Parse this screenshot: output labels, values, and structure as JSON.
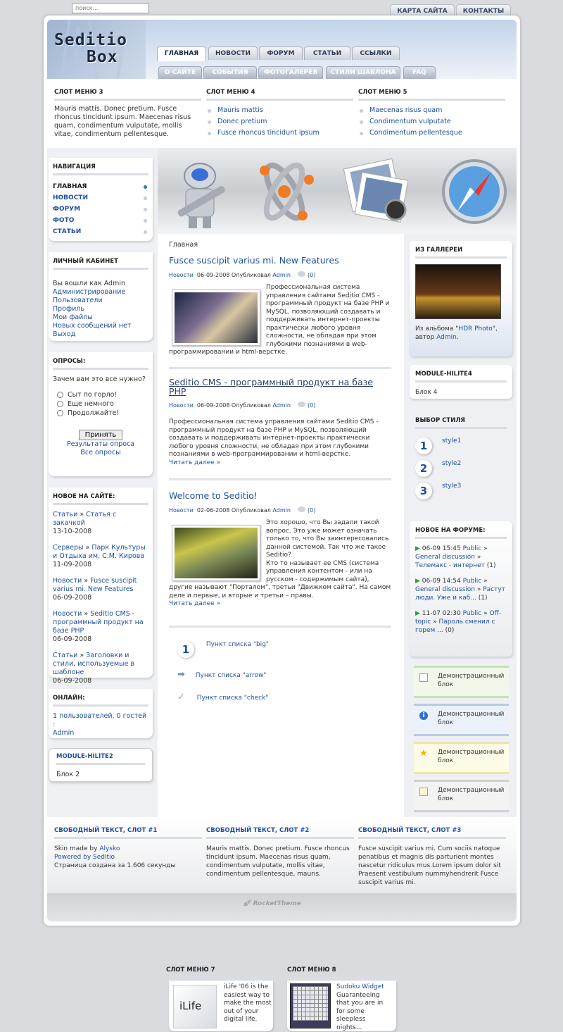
{
  "search": {
    "placeholder": "поиск..."
  },
  "top_tabs": [
    "КАРТА САЙТА",
    "КОНТАКТЫ"
  ],
  "logo": {
    "line1": "Seditio",
    "line2": "Box"
  },
  "main_tabs": [
    "ГЛАВНАЯ",
    "НОВОСТИ",
    "ФОРУМ",
    "СТАТЬИ",
    "ССЫЛКИ"
  ],
  "sub_tabs": [
    "О САЙТЕ",
    "СОБЫТИЯ",
    "ФОТОГАЛЕРЕЯ",
    "СТИЛИ ШАБЛОНА",
    "FAQ"
  ],
  "slot3": {
    "title": "СЛОТ МЕНЮ 3",
    "text": "Mauris mattis. Donec pretium. Fusce rhoncus tincidunt ipsum. Maecenas risus quam, condimentum vulputate, mollis vitae, condimentum pellentesque."
  },
  "slot4": {
    "title": "СЛОТ МЕНЮ 4",
    "items": [
      "Mauris mattis",
      "Donec pretium",
      "Fusce rhoncus tincidunt ipsum"
    ]
  },
  "slot5": {
    "title": "СЛОТ МЕНЮ 5",
    "items": [
      "Maecenas risus quam",
      "Condimentum vulputate",
      "Condimentum pellentesque"
    ]
  },
  "nav": {
    "title": "НАВИГАЦИЯ",
    "items": [
      "ГЛАВНАЯ",
      "НОВОСТИ",
      "ФОРУМ",
      "ФОТО",
      "СТАТЬИ"
    ]
  },
  "cabinet": {
    "title": "ЛИЧНЫЙ КАБИНЕТ",
    "logged": "Вы вошли как Admin",
    "links": [
      "Администрирование",
      "Пользователи",
      "Профиль",
      "Мои файлы",
      "Новых сообщений нет",
      "Выход"
    ]
  },
  "poll": {
    "title": "ОПРОСЫ:",
    "question": "Зачем вам это все нужно?",
    "options": [
      "Сыт по горло!",
      "Еще немного",
      "Продолжайте!"
    ],
    "submit": "Принять",
    "results": "Результаты опроса",
    "all": "Все опросы"
  },
  "newsite": {
    "title": "НОВОЕ НА САЙТЕ:",
    "items": [
      {
        "cat": "Статьи",
        "title": "Статья с закачкой",
        "date": "13-10-2008"
      },
      {
        "cat": "Серверы",
        "title": "Парк Культуры и Отдыха им. С.М. Кирова",
        "date": "11-09-2008"
      },
      {
        "cat": "Новости",
        "title": "Fusce suscipit varius mi. New Features",
        "date": "06-09-2008"
      },
      {
        "cat": "Новости",
        "title": "Seditio CMS - программный продукт на базе PHP",
        "date": "06-09-2008"
      },
      {
        "cat": "Статьи",
        "title": "Заголовки и стили, используемые в шаблоне",
        "date": "06-09-2008"
      }
    ]
  },
  "online": {
    "title": "ОНЛАЙН:",
    "text": "1 пользователей, 0 гостей :",
    "user": "Admin"
  },
  "hilite2": {
    "title": "MODULE-HILITE2",
    "text": "Блок 2"
  },
  "breadcrumb": "Главная",
  "articles": [
    {
      "title": "Fusce suscipit varius mi. New Features",
      "cat": "Новости",
      "date": "06-09-2008 Опубликовал",
      "author": "Admin",
      "comments": "(0)",
      "text": "Профессиональная система управления сайтами Seditio CMS - программный продукт на базе PHP и MySQL, позволяющий создавать и поддерживать интернет-проекты практически любого уровня сложности, не обладая при этом глубокими познаниями в web-программировании и html-верстке."
    },
    {
      "title": "Seditio CMS - программный продукт на базе PHP",
      "cat": "Новости",
      "date": "06-09-2008 Опубликовал",
      "author": "Admin",
      "comments": "(0)",
      "text": "Профессиональная система управления сайтами Seditio CMS - программный продукт на базе PHP и MySQL, позволяющий создавать и поддерживать интернет-проекты практически любого уровня сложности, не обладая при этом глубокими познаниями в web-программировании и html-верстке.",
      "more": "Читать далее »"
    },
    {
      "title": "Welcome to Seditio!",
      "cat": "Новости",
      "date": "02-06-2008 Опубликовал",
      "author": "Admin",
      "comments": "(0)",
      "text": "Это хорошо, что Вы задали такой вопрос. Это уже может означать только то, что Вы заинтересовались данной системой. Так что же такое Seditio?",
      "text2": "Кто то называет ее CMS (система управления контентом - или на русском - содержимым сайта), другие называют \"Порталом\", третьи \"Движком сайта\". На самом деле и первые, и вторые и третьи – правы.",
      "more": "Читать далее »"
    }
  ],
  "lists": {
    "big_num": "1",
    "big": "Пункт списка \"big\"",
    "arrow": "Пункт списка \"arrow\"",
    "check": "Пункт списка \"check\""
  },
  "slot7": {
    "title": "СЛОТ МЕНЮ 7",
    "label": "iLife",
    "text": "iLife '06 is the easiest way to make the most out of your digital life."
  },
  "slot8": {
    "title": "СЛОТ МЕНЮ 8",
    "link": "Sudoku Widget",
    "text": "Guaranteeing that you are in for some sleepless nights..."
  },
  "gallery": {
    "title": "ИЗ ГАЛЛЕРЕИ",
    "pre": "Из альбома \"",
    "album": "HDR Photo",
    "mid": "\", автор",
    "author": "Admin"
  },
  "hilite4": {
    "title": "MODULE-HILITE4",
    "text": "Блок 4"
  },
  "styles": {
    "title": "ВЫБОР СТИЛЯ",
    "nums": [
      "1",
      "2",
      "3"
    ],
    "items": [
      "style1",
      "style2",
      "style3"
    ]
  },
  "forum": {
    "title": "НОВОЕ НА ФОРУМЕ:",
    "items": [
      {
        "time": "06-09 15:45",
        "sec": "Public",
        "topic": "General discussion",
        "post": "Телемакс - интернет",
        "count": "(1)"
      },
      {
        "time": "06-09 14:54",
        "sec": "Public",
        "topic": "General discussion",
        "post": "Растут люди. Уже и каб...",
        "count": "(1)"
      },
      {
        "time": "11-07 02:30",
        "sec": "Public",
        "topic": "Off-topic",
        "post": "Пароль сменил с горем ...",
        "count": "(0)"
      }
    ]
  },
  "demos": [
    "Демонстрационный блок",
    "Демонстрационный блок",
    "Демонстрационный блок",
    "Демонстрационный блок"
  ],
  "footer": {
    "c1": {
      "title": "СВОБОДНЫЙ ТЕКСТ, СЛОТ #1",
      "skin": "Skin made by",
      "skin_author": "Alysko",
      "powered": "Powered by Seditio",
      "gen": "Страница создана за 1.606 секунды"
    },
    "c2": {
      "title": "СВОБОДНЫЙ ТЕКСТ, СЛОТ #2",
      "text": "Mauris mattis. Donec pretium. Fusce rhoncus tincidunt ipsum. Maecenas risus quam, condimentum vulputate, mollis vitae, condimentum pellentesque, mauris."
    },
    "c3": {
      "title": "СВОБОДНЫЙ ТЕКСТ, СЛОТ #3",
      "text": "Fusce suscipit varius mi. Cum sociis natoque penatibus et magnis dis parturient montes nascetur ridiculus mus.Lorem ipsum dolor sit Praesent vestibulum nummyhendrerit Fusce suscipit varius mi."
    }
  },
  "rocket": "RocketTheme"
}
